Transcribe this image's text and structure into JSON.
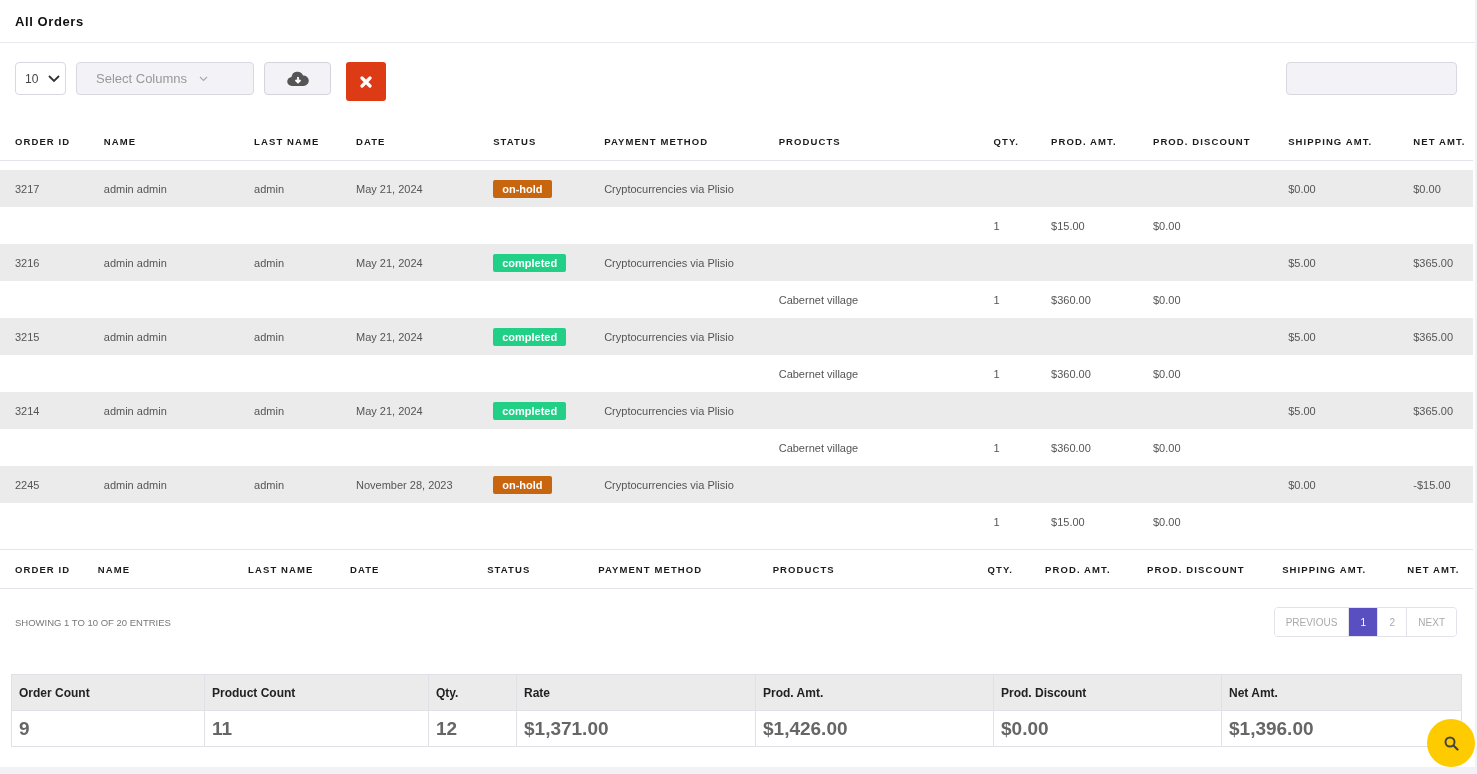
{
  "title": "All Orders",
  "toolbar": {
    "page_size": "10",
    "select_columns": {
      "placeholder": "Select Columns"
    }
  },
  "columns": [
    "ORDER ID",
    "NAME",
    "LAST NAME",
    "DATE",
    "STATUS",
    "PAYMENT METHOD",
    "PRODUCTS",
    "QTY.",
    "PROD. AMT.",
    "PROD. DISCOUNT",
    "SHIPPING AMT.",
    "NET AMT."
  ],
  "orders": [
    {
      "order_id": "3217",
      "name": "admin admin",
      "last_name": "admin",
      "date": "May 21, 2024",
      "status": {
        "label": "on-hold",
        "color": "#c8650f"
      },
      "payment_method": "Cryptocurrencies via Plisio",
      "shipping_amt": "$0.00",
      "net_amt": "$0.00",
      "item": {
        "qty": "1",
        "prod_amt": "$15.00",
        "prod_discount": "$0.00"
      }
    },
    {
      "order_id": "3216",
      "name": "admin admin",
      "last_name": "admin",
      "date": "May 21, 2024",
      "status": {
        "label": "completed",
        "color": "#21cf86"
      },
      "payment_method": "Cryptocurrencies via Plisio",
      "shipping_amt": "$5.00",
      "net_amt": "$365.00",
      "item": {
        "product": "Cabernet village",
        "qty": "1",
        "prod_amt": "$360.00",
        "prod_discount": "$0.00"
      }
    },
    {
      "order_id": "3215",
      "name": "admin admin",
      "last_name": "admin",
      "date": "May 21, 2024",
      "status": {
        "label": "completed",
        "color": "#21cf86"
      },
      "payment_method": "Cryptocurrencies via Plisio",
      "shipping_amt": "$5.00",
      "net_amt": "$365.00",
      "item": {
        "product": "Cabernet village",
        "qty": "1",
        "prod_amt": "$360.00",
        "prod_discount": "$0.00"
      }
    },
    {
      "order_id": "3214",
      "name": "admin admin",
      "last_name": "admin",
      "date": "May 21, 2024",
      "status": {
        "label": "completed",
        "color": "#21cf86"
      },
      "payment_method": "Cryptocurrencies via Plisio",
      "shipping_amt": "$5.00",
      "net_amt": "$365.00",
      "item": {
        "product": "Cabernet village",
        "qty": "1",
        "prod_amt": "$360.00",
        "prod_discount": "$0.00"
      }
    },
    {
      "order_id": "2245",
      "name": "admin admin",
      "last_name": "admin",
      "date": "November 28, 2023",
      "status": {
        "label": "on-hold",
        "color": "#c8650f"
      },
      "payment_method": "Cryptocurrencies via Plisio",
      "shipping_amt": "$0.00",
      "net_amt": "-$15.00",
      "item": {
        "qty": "1",
        "prod_amt": "$15.00",
        "prod_discount": "$0.00"
      }
    }
  ],
  "footer_columns": [
    "ORDER ID",
    "NAME",
    "LAST NAME",
    "DATE",
    "STATUS",
    "PAYMENT METHOD",
    "PRODUCTS",
    "QTY.",
    "PROD. AMT.",
    "PROD. DISCOUNT",
    "SHIPPING AMT.",
    "NET AMT."
  ],
  "entries_info": "SHOWING 1 TO 10 OF 20 ENTRIES",
  "pagination": [
    {
      "label": "PREVIOUS",
      "kind": "nav",
      "selected": false
    },
    {
      "label": "1",
      "kind": "page",
      "selected": true
    },
    {
      "label": "2",
      "kind": "page",
      "selected": false
    },
    {
      "label": "NEXT",
      "kind": "nav",
      "selected": false
    }
  ],
  "summary": {
    "columns": [
      "Order Count",
      "Product Count",
      "Qty.",
      "Rate",
      "Prod. Amt.",
      "Prod. Discount",
      "Net Amt."
    ],
    "values": [
      "9",
      "11",
      "12",
      "$1,371.00",
      "$1,426.00",
      "$0.00",
      "$1,396.00"
    ]
  }
}
